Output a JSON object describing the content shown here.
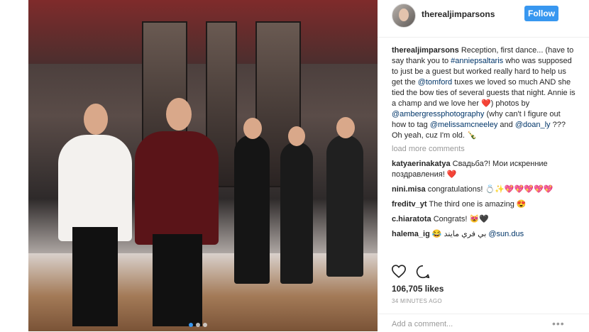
{
  "header": {
    "username": "therealjimparsons",
    "follow_label": "Follow"
  },
  "caption": {
    "user": "therealjimparsons",
    "part1": " Reception, first dance... (have to say thank you to ",
    "mention1": "#anniepsaltaris",
    "part2": " who was supposed to just be a guest but worked really hard to help us get the ",
    "mention2": "@tomford",
    "part3": " tuxes we loved so much AND she tied the bow ties of several guests that night. Annie is a champ and we love her ❤️) photos by ",
    "mention3": "@ambergressphotography",
    "part4": " (why can't I figure out how to tag ",
    "mention4": "@melissamcneeley",
    "part5": " and ",
    "mention5": "@doan_ly",
    "part6": " ??? Oh yeah, cuz I'm old. 🍾"
  },
  "load_more_label": "load more comments",
  "comments": [
    {
      "user": "katyaerinakatya",
      "text": " Свадьба?! Мои искренние поздравления! ❤️"
    },
    {
      "user": "nini.misa",
      "text": " congratulations! 💍✨💖💖💖💖💖"
    },
    {
      "user": "freditv_yt",
      "text": " The third one is amazing 😍"
    },
    {
      "user": "c.hiaratota",
      "text": " Congrats! 😻🖤"
    },
    {
      "user": "halema_ig",
      "text": " 😂 بي فري مايند ",
      "mention": "@sun.dus"
    }
  ],
  "icons": {
    "heart": "heart-icon",
    "comment": "comment-icon",
    "more": "more-options-icon"
  },
  "likes": "106,705 likes",
  "timestamp": "34 MINUTES AGO",
  "add_comment_placeholder": "Add a comment...",
  "colors": {
    "accent": "#3897f0",
    "mention": "#003569",
    "muted": "#999999"
  }
}
